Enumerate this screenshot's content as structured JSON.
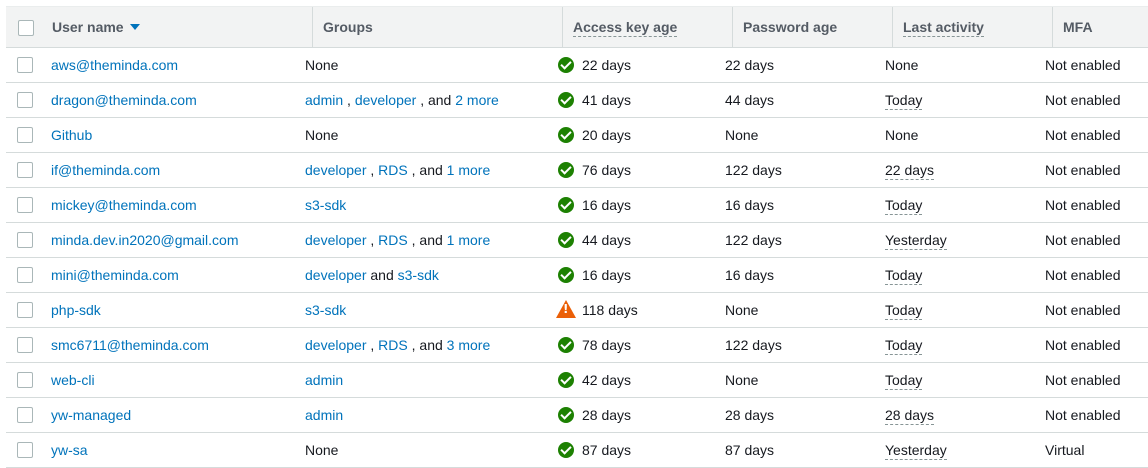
{
  "header": {
    "user_name": "User name",
    "groups": "Groups",
    "access_key_age": "Access key age",
    "password_age": "Password age",
    "last_activity": "Last activity",
    "mfa": "MFA"
  },
  "rows": [
    {
      "user": "aws@theminda.com",
      "groups": [
        {
          "text": "None",
          "link": false
        }
      ],
      "key_status": "ok",
      "key_age": "22 days",
      "password_age": "22 days",
      "last_activity": "None",
      "last_activity_dotted": false,
      "mfa": "Not enabled"
    },
    {
      "user": "dragon@theminda.com",
      "groups": [
        {
          "text": "admin",
          "link": true
        },
        {
          "text": " , ",
          "link": false
        },
        {
          "text": "developer",
          "link": true
        },
        {
          "text": " , and ",
          "link": false
        },
        {
          "text": "2 more",
          "link": true
        }
      ],
      "key_status": "ok",
      "key_age": "41 days",
      "password_age": "44 days",
      "last_activity": "Today",
      "last_activity_dotted": true,
      "mfa": "Not enabled"
    },
    {
      "user": "Github",
      "groups": [
        {
          "text": "None",
          "link": false
        }
      ],
      "key_status": "ok",
      "key_age": "20 days",
      "password_age": "None",
      "last_activity": "None",
      "last_activity_dotted": false,
      "mfa": "Not enabled"
    },
    {
      "user": "if@theminda.com",
      "groups": [
        {
          "text": "developer",
          "link": true
        },
        {
          "text": " , ",
          "link": false
        },
        {
          "text": "RDS",
          "link": true
        },
        {
          "text": " , and ",
          "link": false
        },
        {
          "text": "1 more",
          "link": true
        }
      ],
      "key_status": "ok",
      "key_age": "76 days",
      "password_age": "122 days",
      "last_activity": "22 days",
      "last_activity_dotted": true,
      "mfa": "Not enabled"
    },
    {
      "user": "mickey@theminda.com",
      "groups": [
        {
          "text": "s3-sdk",
          "link": true
        }
      ],
      "key_status": "ok",
      "key_age": "16 days",
      "password_age": "16 days",
      "last_activity": "Today",
      "last_activity_dotted": true,
      "mfa": "Not enabled"
    },
    {
      "user": "minda.dev.in2020@gmail.com",
      "groups": [
        {
          "text": "developer",
          "link": true
        },
        {
          "text": " , ",
          "link": false
        },
        {
          "text": "RDS",
          "link": true
        },
        {
          "text": " , and ",
          "link": false
        },
        {
          "text": "1 more",
          "link": true
        }
      ],
      "key_status": "ok",
      "key_age": "44 days",
      "password_age": "122 days",
      "last_activity": "Yesterday",
      "last_activity_dotted": true,
      "mfa": "Not enabled"
    },
    {
      "user": "mini@theminda.com",
      "groups": [
        {
          "text": "developer",
          "link": true
        },
        {
          "text": " and ",
          "link": false
        },
        {
          "text": "s3-sdk",
          "link": true
        }
      ],
      "key_status": "ok",
      "key_age": "16 days",
      "password_age": "16 days",
      "last_activity": "Today",
      "last_activity_dotted": true,
      "mfa": "Not enabled"
    },
    {
      "user": "php-sdk",
      "groups": [
        {
          "text": "s3-sdk",
          "link": true
        }
      ],
      "key_status": "warning",
      "key_age": "118 days",
      "password_age": "None",
      "last_activity": "Today",
      "last_activity_dotted": true,
      "mfa": "Not enabled"
    },
    {
      "user": "smc6711@theminda.com",
      "groups": [
        {
          "text": "developer",
          "link": true
        },
        {
          "text": " , ",
          "link": false
        },
        {
          "text": "RDS",
          "link": true
        },
        {
          "text": " , and ",
          "link": false
        },
        {
          "text": "3 more",
          "link": true
        }
      ],
      "key_status": "ok",
      "key_age": "78 days",
      "password_age": "122 days",
      "last_activity": "Today",
      "last_activity_dotted": true,
      "mfa": "Not enabled"
    },
    {
      "user": "web-cli",
      "groups": [
        {
          "text": "admin",
          "link": true
        }
      ],
      "key_status": "ok",
      "key_age": "42 days",
      "password_age": "None",
      "last_activity": "Today",
      "last_activity_dotted": true,
      "mfa": "Not enabled"
    },
    {
      "user": "yw-managed",
      "groups": [
        {
          "text": "admin",
          "link": true
        }
      ],
      "key_status": "ok",
      "key_age": "28 days",
      "password_age": "28 days",
      "last_activity": "28 days",
      "last_activity_dotted": true,
      "mfa": "Not enabled"
    },
    {
      "user": "yw-sa",
      "groups": [
        {
          "text": "None",
          "link": false
        }
      ],
      "key_status": "ok",
      "key_age": "87 days",
      "password_age": "87 days",
      "last_activity": "Yesterday",
      "last_activity_dotted": true,
      "mfa": "Virtual"
    }
  ]
}
